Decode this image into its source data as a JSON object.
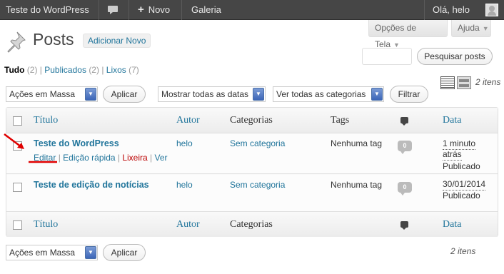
{
  "admin_bar": {
    "site_name": "Teste do WordPress",
    "new_label": "Novo",
    "gallery_label": "Galeria",
    "greeting": "Olá, helo",
    "icons": [
      "comment-bubble-icon",
      "plus-icon",
      "avatar-icon"
    ]
  },
  "screen_meta": {
    "screen_options": "Opções de Tela",
    "help": "Ajuda"
  },
  "header": {
    "title": "Posts",
    "add_new": "Adicionar Novo",
    "icon": "pushpin-icon"
  },
  "search": {
    "value": "",
    "button": "Pesquisar posts"
  },
  "filters_links": [
    {
      "label": "Tudo",
      "count": "(2)",
      "current": true
    },
    {
      "label": "Publicados",
      "count": "(2)",
      "current": false
    },
    {
      "label": "Lixos",
      "count": "(7)",
      "current": false
    }
  ],
  "tablenav_top": {
    "bulk_actions": "Ações em Massa",
    "apply": "Aplicar",
    "dates": "Mostrar todas as datas",
    "categories": "Ver todas as categorias",
    "filter": "Filtrar",
    "items_count": "2 itens"
  },
  "tablenav_bottom": {
    "bulk_actions": "Ações em Massa",
    "apply": "Aplicar",
    "items_count": "2 itens"
  },
  "columns": {
    "title": "Título",
    "author": "Autor",
    "categories": "Categorias",
    "tags": "Tags",
    "date": "Data"
  },
  "rows": [
    {
      "title": "Teste do WordPress",
      "actions": {
        "edit": "Editar",
        "quick_edit": "Edição rápida",
        "trash": "Lixeira",
        "view": "Ver"
      },
      "author": "helo",
      "category": "Sem categoria",
      "tags": "Nenhuma tag",
      "comments": "0",
      "date_line1": "1 minuto",
      "date_line2": "atrás",
      "status": "Publicado"
    },
    {
      "title": "Teste de edição de notícias",
      "author": "helo",
      "category": "Sem categoria",
      "tags": "Nenhuma tag",
      "comments": "0",
      "date_line1": "30/01/2014",
      "status": "Publicado"
    }
  ],
  "colors": {
    "admin_bar": "#464646",
    "link": "#21759b",
    "trash": "#bb0000",
    "annotation": "#e00000"
  }
}
